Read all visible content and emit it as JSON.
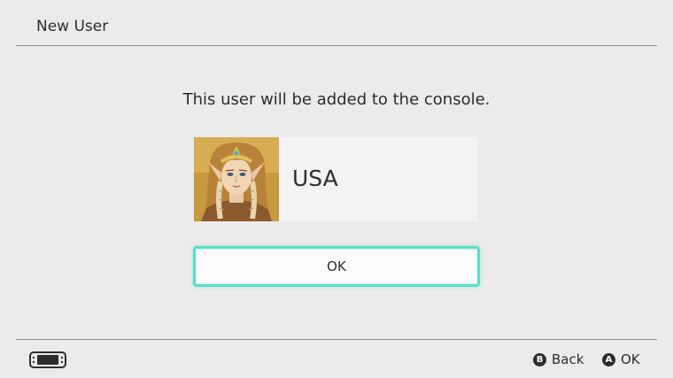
{
  "header": {
    "title": "New User"
  },
  "main": {
    "message": "This user will be added to the console.",
    "user": {
      "name": "USA",
      "avatar_icon": "character-portrait"
    },
    "ok_label": "OK"
  },
  "footer": {
    "console_icon": "handheld-console-icon",
    "hints": [
      {
        "button": "B",
        "label": "Back"
      },
      {
        "button": "A",
        "label": "OK"
      }
    ]
  },
  "colors": {
    "background": "#ebebeb",
    "focus_border": "#51e3c8",
    "divider": "#8f8f8f",
    "text": "#2d2d2d"
  }
}
